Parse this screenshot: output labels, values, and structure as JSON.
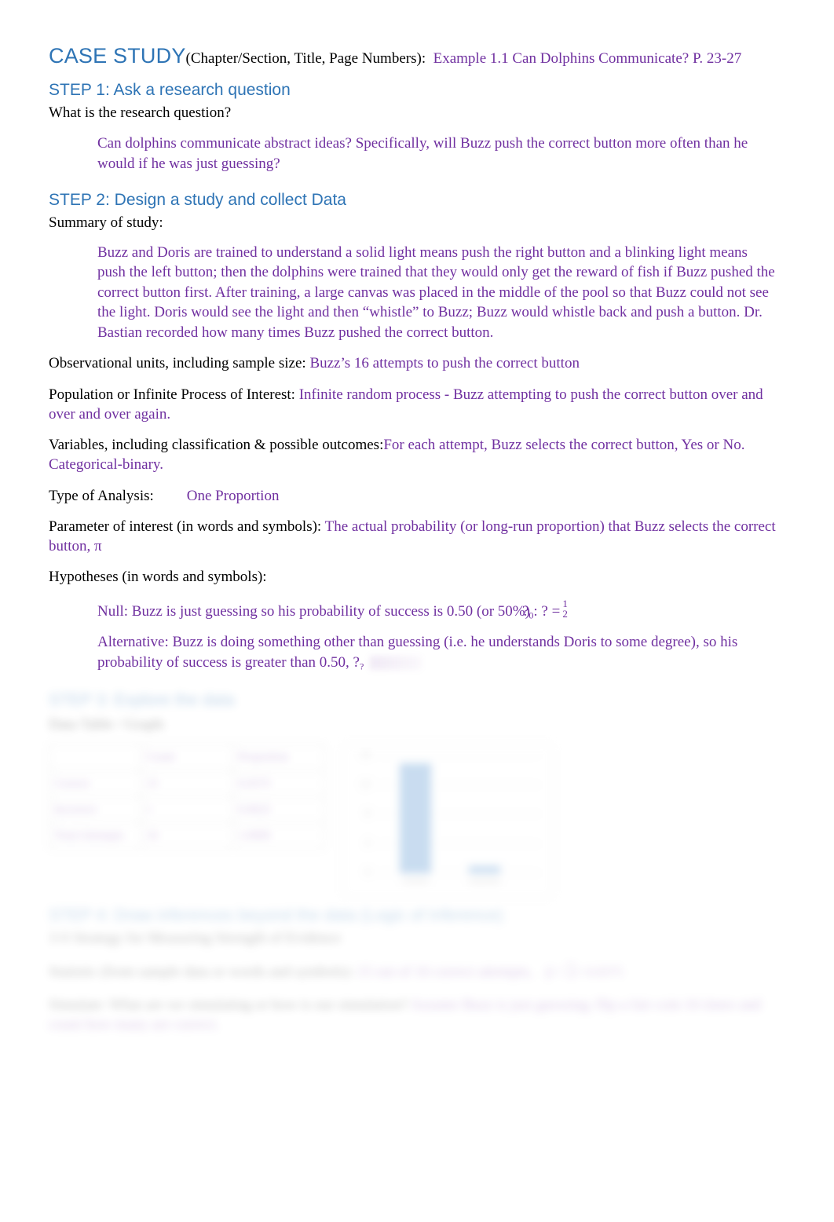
{
  "document": {
    "title_label": "CASE STUDY",
    "title_paren": "(Chapter/Section, Title, Page Numbers):",
    "title_value": "Example 1.1 Can Dolphins Communicate? P. 23-27"
  },
  "step1": {
    "heading": "STEP 1: Ask a research question",
    "prompt": "What is the research question?",
    "answer": "Can dolphins communicate abstract ideas? Specifically, will Buzz push the correct button more often than he would if he was just guessing?"
  },
  "step2": {
    "heading": "STEP 2: Design a study and collect Data",
    "summary_label": "Summary of study:",
    "summary_answer": "Buzz and Doris are trained to understand a solid light means push the right button and a blinking light means push the left button; then the dolphins were trained that they would only get the reward of fish if Buzz pushed the correct button first. After training, a large canvas was placed in the middle of the pool so that Buzz could not see the light. Doris would see the light and then “whistle” to Buzz; Buzz would whistle back and push a button. Dr. Bastian recorded how many times Buzz pushed the correct button.",
    "obs_label": "Observational units, including sample size:",
    "obs_answer": "Buzz’s 16 attempts to push the correct button",
    "pop_label": "Population or Infinite Process of Interest:",
    "pop_answer": "Infinite random process - Buzz attempting to push the correct button over and over and over again.",
    "vars_label": "Variables, including classification & possible outcomes:",
    "vars_answer": "For each attempt, Buzz selects the correct button, Yes or No. Categorical-binary.",
    "analysis_label": "Type of Analysis:",
    "analysis_answer": "One Proportion",
    "param_label": "Parameter of interest (in words and symbols):",
    "param_answer": "The actual probability (or long-run proportion) that Buzz selects the correct button,  π",
    "hyp_label": "Hypotheses (in words and symbols):",
    "null_text": "Null: Buzz is just guessing so his probability of success is 0.50 (or 50%)",
    "null_eq_lead": "?",
    "null_eq_sub": "0",
    "null_eq_mid": ": ? =",
    "null_eq_num": "1",
    "null_eq_den": "2",
    "alt_text": "Alternative: Buzz is doing something other than guessing (i.e. he understands Doris to some degree), so his probability of success is greater than 0.50,  ?",
    "alt_eq_sub": "?"
  },
  "step3": {
    "heading": "STEP 3: Explore the data",
    "prompt": "Data Table / Graph:",
    "table": {
      "headers": [
        "",
        "Count",
        "Proportion"
      ],
      "rows": [
        [
          "Correct",
          "15",
          "0.9375"
        ],
        [
          "Incorrect",
          "1",
          "0.0625"
        ],
        [
          "Total Attempts",
          "16",
          "1.0000"
        ]
      ]
    },
    "chart_data": {
      "type": "bar",
      "title": "",
      "categories": [
        "Correct",
        "Incorrect"
      ],
      "values": [
        15,
        1
      ],
      "xlabel": "",
      "ylabel": "",
      "ylim": [
        0,
        16
      ],
      "yticks": [
        0,
        4,
        8,
        12,
        16
      ],
      "grid": true,
      "legend": "none",
      "bar_color": "#4E8FD0"
    }
  },
  "step4": {
    "heading": "STEP 4: Draw inferences beyond the data (Logic of Inference)",
    "subheading": "3-S Strategy for Measuring Strength of Evidence",
    "statistic_label": "Statistic (from sample data or words and symbols):",
    "statistic_answer": "15 out of 16 correct attempts,",
    "statistic_eq_lead": "p̂ =",
    "statistic_eq_num": "15",
    "statistic_eq_den": "16",
    "statistic_eq_val": "= 0.9375",
    "sim_label": "Simulate: What are we simulating or how is our simulation?",
    "sim_answer": "Assume Buzz is just guessing; flip a fair coin 16 times and count how many are correct."
  },
  "colors": {
    "heading_blue": "#2E74B5",
    "answer_purple": "#7030A0",
    "body_black": "#000000",
    "bar_blue": "#4E8FD0"
  }
}
